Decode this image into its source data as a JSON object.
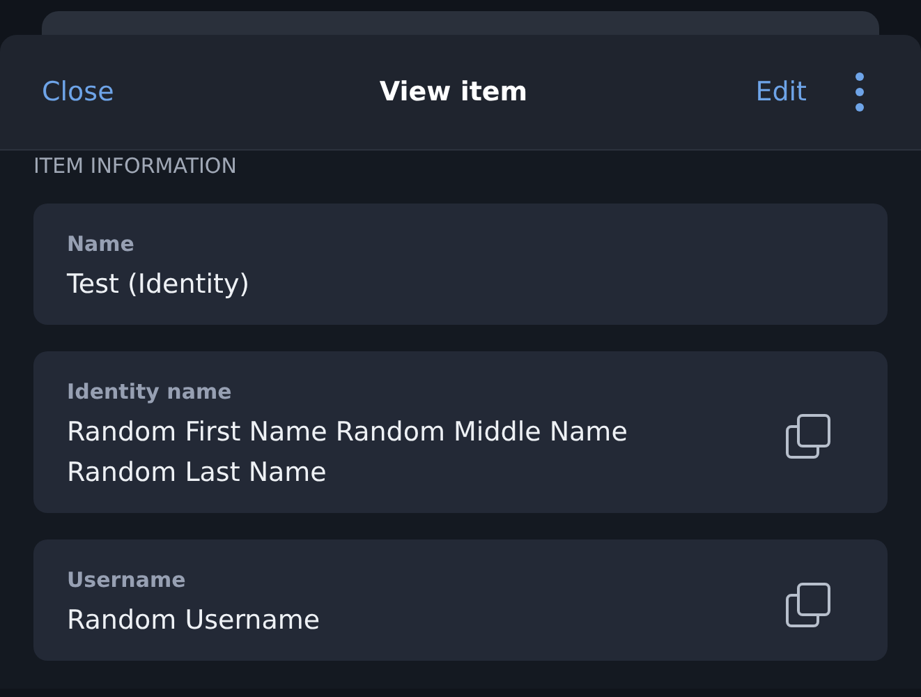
{
  "header": {
    "close": "Close",
    "title": "View item",
    "edit": "Edit"
  },
  "section_title": "ITEM INFORMATION",
  "fields": [
    {
      "label": "Name",
      "value": "Test (Identity)",
      "copyable": false
    },
    {
      "label": "Identity name",
      "value": "Random First Name Random Middle Name Random Last Name",
      "copyable": true
    },
    {
      "label": "Username",
      "value": "Random Username",
      "copyable": true
    }
  ]
}
